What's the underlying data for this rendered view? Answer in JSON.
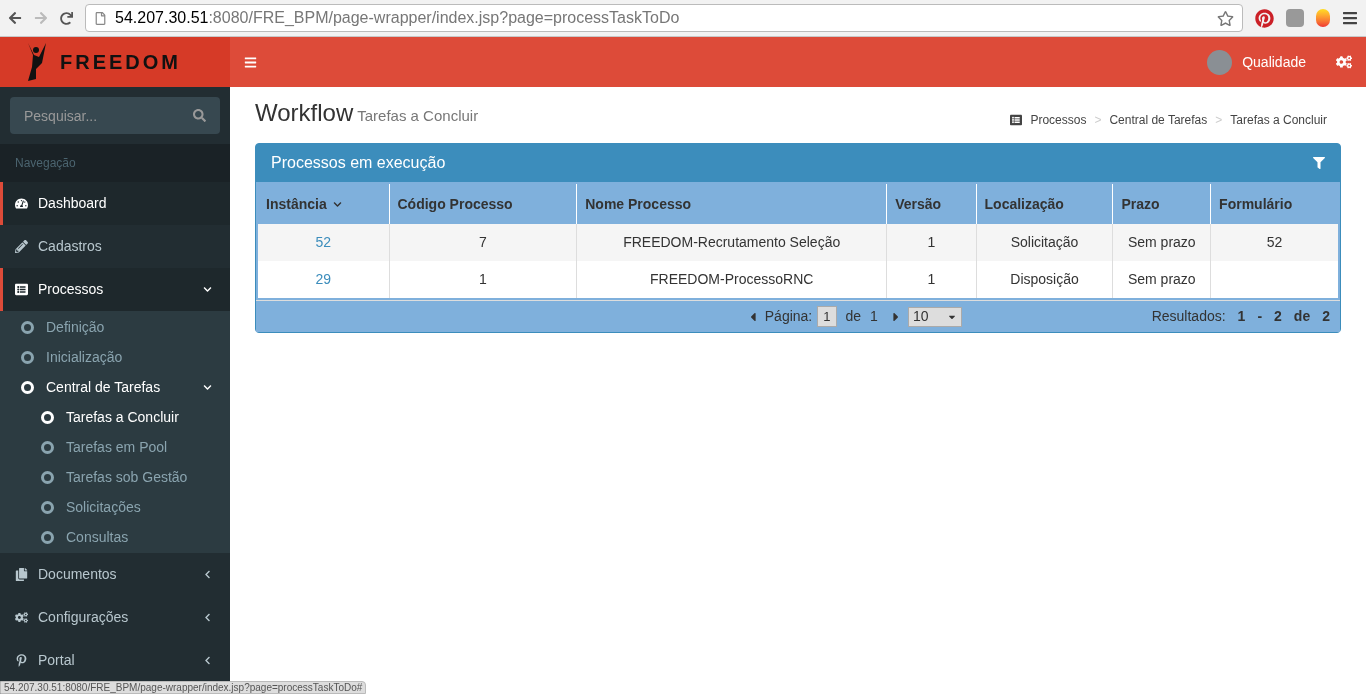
{
  "browser": {
    "url_host": "54.207.30.51",
    "url_path": ":8080/FRE_BPM/page-wrapper/index.jsp?page=processTaskToDo",
    "status_url": "54.207.30.51:8080/FRE_BPM/page-wrapper/index.jsp?page=processTaskToDo#"
  },
  "header": {
    "logo": "FREEDOM",
    "user": "Qualidade"
  },
  "sidebar": {
    "search": {
      "placeholder": "Pesquisar..."
    },
    "section": "Navegação",
    "items": [
      {
        "label": "Dashboard",
        "selected": false,
        "marked": true
      },
      {
        "label": "Cadastros",
        "selected": false,
        "marked": false
      },
      {
        "label": "Processos",
        "selected": false,
        "marked": true,
        "expanded": true,
        "children": [
          {
            "label": "Definição",
            "selected": false
          },
          {
            "label": "Inicialização",
            "selected": false
          },
          {
            "label": "Central de Tarefas",
            "selected": true,
            "expanded": true,
            "children": [
              {
                "label": "Tarefas a Concluir",
                "selected": true
              },
              {
                "label": "Tarefas em Pool",
                "selected": false
              },
              {
                "label": "Tarefas sob Gestão",
                "selected": false
              },
              {
                "label": "Solicitações",
                "selected": false
              },
              {
                "label": "Consultas",
                "selected": false
              }
            ]
          }
        ]
      },
      {
        "label": "Documentos",
        "selected": false,
        "marked": false,
        "expanded": false
      },
      {
        "label": "Configurações",
        "selected": false,
        "marked": false,
        "expanded": false
      },
      {
        "label": "Portal",
        "selected": false,
        "marked": false,
        "expanded": false
      }
    ]
  },
  "page": {
    "title": "Workflow",
    "subtitle": "Tarefas a Concluir",
    "breadcrumb": [
      "Processos",
      "Central de Tarefas",
      "Tarefas a Concluir"
    ],
    "breadcrumb_separator": ">"
  },
  "panel": {
    "title": "Processos em execução",
    "table": {
      "columns": [
        "Instância",
        "Código Processo",
        "Nome Processo",
        "Versão",
        "Localização",
        "Prazo",
        "Formulário"
      ],
      "rows": [
        [
          "52",
          "7",
          "FREEDOM-Recrutamento Seleção",
          "1",
          "Solicitação",
          "Sem prazo",
          "52"
        ],
        [
          "29",
          "1",
          "FREEDOM-ProcessoRNC",
          "1",
          "Disposição",
          "Sem prazo",
          ""
        ]
      ]
    },
    "pager": {
      "label": "Página:",
      "page": "1",
      "of": "de",
      "total": "1",
      "page_size": "10",
      "results_label": "Resultados:",
      "results": [
        "1",
        "-",
        "2",
        "de",
        "2"
      ]
    }
  }
}
